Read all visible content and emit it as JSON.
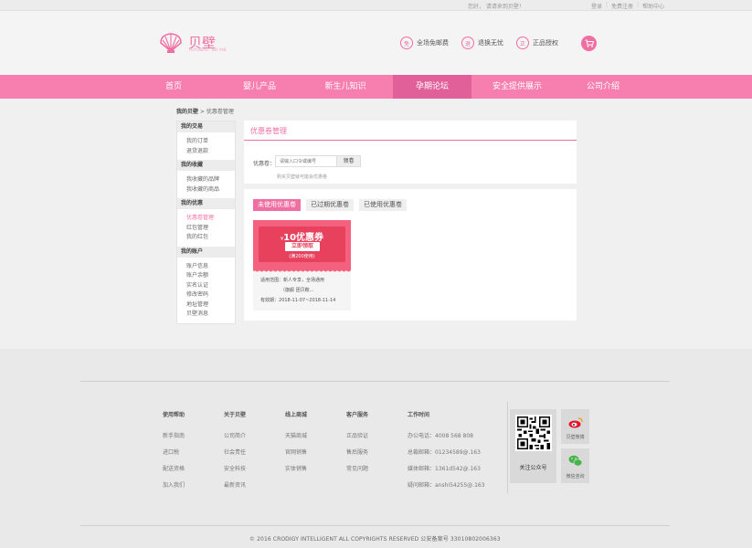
{
  "topbar": {
    "greeting": "您好，  请请来到贝壁！",
    "login": "登录",
    "register": "免费注册",
    "help": "帮助中心"
  },
  "header": {
    "logo_text": "贝壁",
    "logo_sub": "FEIYUBIAO · BEI YAN",
    "features": [
      {
        "icon": "free-shipping-icon",
        "glyph": "免",
        "label": "全场免邮费"
      },
      {
        "icon": "return-icon",
        "glyph": "退",
        "label": "退换无忧"
      },
      {
        "icon": "authorized-icon",
        "glyph": "正",
        "label": "正品授权"
      }
    ],
    "cart_icon": "cart-icon"
  },
  "nav": {
    "items": [
      "首页",
      "婴儿产品",
      "新生儿知识",
      "孕期论坛",
      "安全提供展示",
      "公司介绍"
    ],
    "active_index": 3
  },
  "breadcrumb": {
    "root": "我的贝壁",
    "sep": " > ",
    "current": "优惠卷管理"
  },
  "sidebar": {
    "sections": [
      {
        "title": "我的交易",
        "items": [
          "我的订单",
          "退货退款"
        ]
      },
      {
        "title": "我的收藏",
        "items": [
          "我收藏的品牌",
          "我收藏的商品"
        ]
      },
      {
        "title": "我的优惠",
        "items": [
          "优惠卷管理",
          "红包管理",
          "我的红包"
        ]
      },
      {
        "title": "我的账户",
        "items": [
          "账户信息",
          "账户余额",
          "实名认证",
          "修改密码",
          "地址管理",
          "贝壁消息"
        ]
      }
    ],
    "active_item": "优惠卷管理"
  },
  "coupon_mgmt": {
    "title": "优惠卷管理",
    "label": "优惠卷：",
    "input_placeholder": "请输入口令或编号",
    "button": "领卷",
    "tip": "购买贝壁就可能会优惠卷"
  },
  "coupon_list": {
    "tabs": [
      "未使用优惠卷",
      "已过期优惠卷",
      "已使用优惠卷"
    ],
    "active_tab": 0,
    "card": {
      "currency": "¥",
      "amount": "10",
      "unit": "优惠券",
      "get_label": "立即领取",
      "condition": "(满200使用)",
      "scope_label": "适用范围：",
      "scope": "新人专享，全场通用",
      "scope_more": "（旗舰 团贝鞍...",
      "valid_label": "有效期：",
      "valid": "2018-11-07~2018-11-14"
    }
  },
  "footer": {
    "columns": [
      {
        "title": "使用帮助",
        "links": [
          "新手指南",
          "进口税",
          "配送资格",
          "加入我们"
        ]
      },
      {
        "title": "关于贝壁",
        "links": [
          "公司简介",
          "社会责任",
          "安全科技",
          "最新资讯"
        ]
      },
      {
        "title": "线上商城",
        "links": [
          "天猫商城",
          "官网销售",
          "实体销售"
        ]
      },
      {
        "title": "客户服务",
        "links": [
          "正品验证",
          "售后服务",
          "常见问题"
        ]
      },
      {
        "title": "工作时间",
        "links": [
          "办公电话：4008 568 808",
          "总裁邮箱：01234589@.163",
          "媒体邮箱：1361d542@.163",
          "疑问邮箱：anshi54255@.163"
        ]
      }
    ],
    "qr_caption": "关注公众号",
    "weibo_label": "贝壁微博",
    "wechat_label": "微信咨询",
    "copyright": "©  2016  CRODIGY INTELLIGENT ALL COPYRIGHTS RESERVED    公安备案号 33010802006363"
  },
  "colors": {
    "accent": "#f06fa2",
    "nav_bg": "#f77fb0",
    "nav_active": "#e2609a",
    "coupon_red": "#e7415e"
  }
}
